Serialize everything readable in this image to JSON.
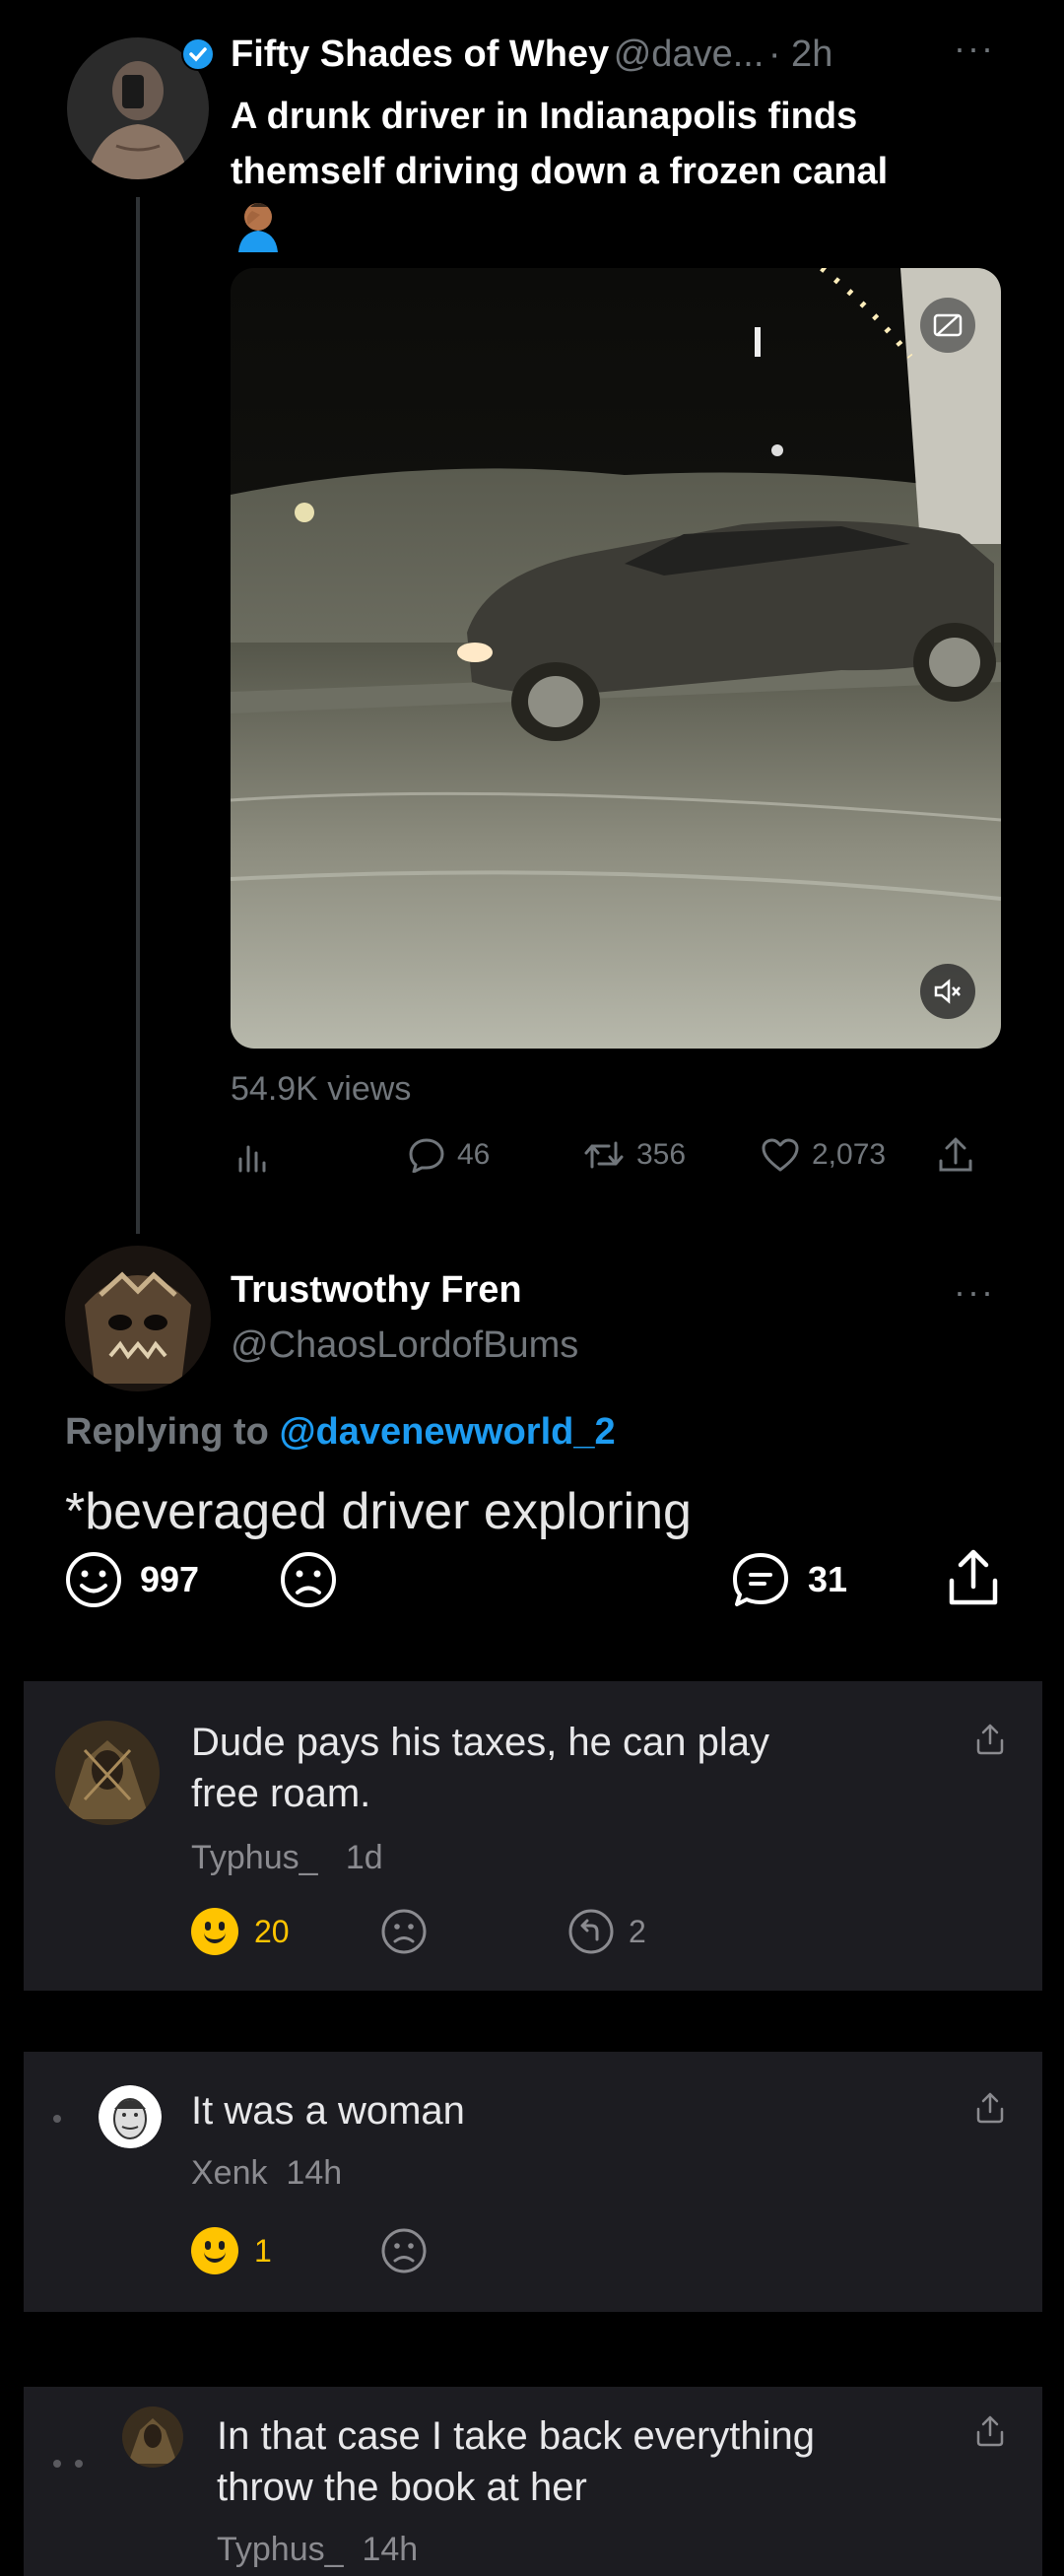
{
  "tweet": {
    "name": "Fifty Shades of Whey",
    "handle": "@dave...",
    "time": "· 2h",
    "text_line1": "A drunk driver in Indianapolis finds",
    "text_line2": "themself driving down a frozen canal",
    "emoji": "🤦🏽‍♂️",
    "views": "54.9K views",
    "replies": "46",
    "retweets": "356",
    "likes": "2,073"
  },
  "reply": {
    "name": "Trustwothy Fren",
    "handle": "@ChaosLordofBums",
    "replying_prefix": "Replying to",
    "replying_to": "@davenewworld_2",
    "text": "*beveraged driver exploring",
    "upvotes": "997",
    "comments": "31"
  },
  "comments": [
    {
      "text_line1": "Dude pays his taxes, he can play",
      "text_line2": "free roam.",
      "author": "Typhus_",
      "time": "1d",
      "likes": "20",
      "replies": "2"
    },
    {
      "text_line1": "It was a woman",
      "author": "Xenk",
      "time": "14h",
      "likes": "1"
    },
    {
      "text_line1": "In that case I take back everything",
      "text_line2": "throw the book at her",
      "author": "Typhus_",
      "time": "14h"
    }
  ],
  "colors": {
    "accent": "#1d9bf0",
    "like_yellow": "#ffc400",
    "card": "#1c1c21"
  }
}
